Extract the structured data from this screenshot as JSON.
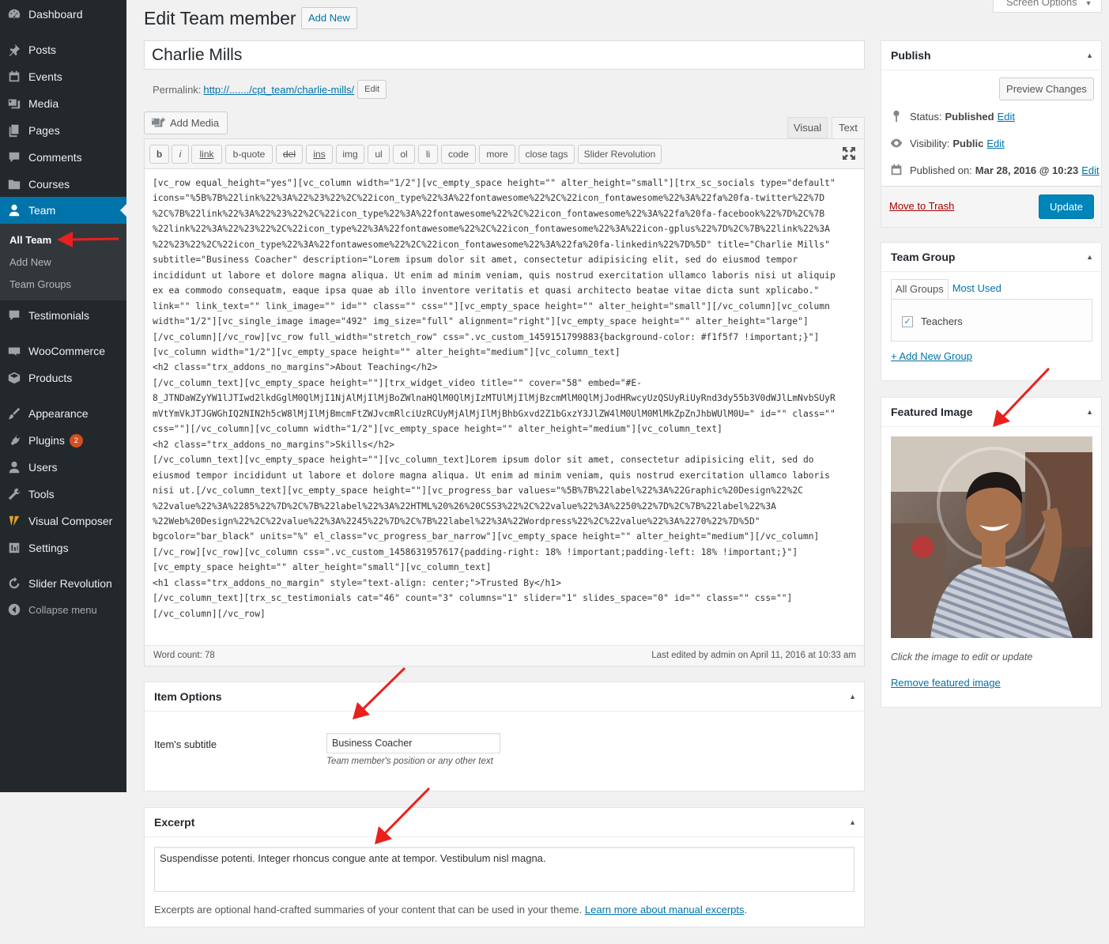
{
  "sidebar": {
    "items": [
      {
        "label": "Dashboard",
        "icon": "dashboard-icon"
      },
      {
        "label": "Posts",
        "icon": "pin-icon"
      },
      {
        "label": "Events",
        "icon": "calendar-icon"
      },
      {
        "label": "Media",
        "icon": "media-icon"
      },
      {
        "label": "Pages",
        "icon": "pages-icon"
      },
      {
        "label": "Comments",
        "icon": "comment-icon"
      },
      {
        "label": "Courses",
        "icon": "folder-icon"
      },
      {
        "label": "Team",
        "icon": "user-icon"
      },
      {
        "label": "Testimonials",
        "icon": "comment-icon"
      },
      {
        "label": "WooCommerce",
        "icon": "woo-icon"
      },
      {
        "label": "Products",
        "icon": "box-icon"
      },
      {
        "label": "Appearance",
        "icon": "brush-icon"
      },
      {
        "label": "Plugins",
        "icon": "plug-icon",
        "badge": "2"
      },
      {
        "label": "Users",
        "icon": "user-icon"
      },
      {
        "label": "Tools",
        "icon": "wrench-icon"
      },
      {
        "label": "Visual Composer",
        "icon": "vc-icon"
      },
      {
        "label": "Settings",
        "icon": "settings-icon"
      },
      {
        "label": "Slider Revolution",
        "icon": "refresh-icon"
      },
      {
        "label": "Collapse menu",
        "icon": "collapse-icon"
      }
    ],
    "team_submenu": [
      "All Team",
      "Add New",
      "Team Groups"
    ]
  },
  "header": {
    "title": "Edit Team member",
    "add_new": "Add New",
    "screen_options": "Screen Options"
  },
  "post": {
    "title": "Charlie Mills",
    "permalink_label": "Permalink:",
    "permalink_url": "http://......./cpt_team/charlie-mills/",
    "edit_label": "Edit"
  },
  "editor": {
    "add_media": "Add Media",
    "tab_visual": "Visual",
    "tab_text": "Text",
    "toolbar": [
      "b",
      "i",
      "link",
      "b-quote",
      "del",
      "ins",
      "img",
      "ul",
      "ol",
      "li",
      "code",
      "more",
      "close tags",
      "Slider Revolution"
    ],
    "content": "[vc_row equal_height=\"yes\"][vc_column width=\"1/2\"][vc_empty_space height=\"\" alter_height=\"small\"][trx_sc_socials type=\"default\"\nicons=\"%5B%7B%22link%22%3A%22%23%22%2C%22icon_type%22%3A%22fontawesome%22%2C%22icon_fontawesome%22%3A%22fa%20fa-twitter%22%7D\n%2C%7B%22link%22%3A%22%23%22%2C%22icon_type%22%3A%22fontawesome%22%2C%22icon_fontawesome%22%3A%22fa%20fa-facebook%22%7D%2C%7B\n%22link%22%3A%22%23%22%2C%22icon_type%22%3A%22fontawesome%22%2C%22icon_fontawesome%22%3A%22icon-gplus%22%7D%2C%7B%22link%22%3A\n%22%23%22%2C%22icon_type%22%3A%22fontawesome%22%2C%22icon_fontawesome%22%3A%22fa%20fa-linkedin%22%7D%5D\" title=\"Charlie Mills\"\nsubtitle=\"Business Coacher\" description=\"Lorem ipsum dolor sit amet, consectetur adipisicing elit, sed do eiusmod tempor\nincididunt ut labore et dolore magna aliqua. Ut enim ad minim veniam, quis nostrud exercitation ullamco laboris nisi ut aliquip\nex ea commodo consequatm, eaque ipsa quae ab illo inventore veritatis et quasi architecto beatae vitae dicta sunt xplicabo.\"\nlink=\"\" link_text=\"\" link_image=\"\" id=\"\" class=\"\" css=\"\"][vc_empty_space height=\"\" alter_height=\"small\"][/vc_column][vc_column\nwidth=\"1/2\"][vc_single_image image=\"492\" img_size=\"full\" alignment=\"right\"][vc_empty_space height=\"\" alter_height=\"large\"]\n[/vc_column][/vc_row][vc_row full_width=\"stretch_row\" css=\".vc_custom_1459151799883{background-color: #f1f5f7 !important;}\"]\n[vc_column width=\"1/2\"][vc_empty_space height=\"\" alter_height=\"medium\"][vc_column_text]\n<h2 class=\"trx_addons_no_margins\">About Teaching</h2>\n[/vc_column_text][vc_empty_space height=\"\"][trx_widget_video title=\"\" cover=\"58\" embed=\"#E-\n8_JTNDaWZyYW1lJTIwd2lkdGglM0QlMjI1NjAlMjIlMjBoZWlnaHQlM0QlMjIzMTUlMjIlMjBzcmMlM0QlMjJodHRwcyUzQSUyRiUyRnd3dy55b3V0dWJlLmNvbSUyR\nmVtYmVkJTJGWGhIQ2NIN2h5cW8lMjIlMjBmcmFtZWJvcmRlciUzRCUyMjAlMjIlMjBhbGxvd2Z1bGxzY3JlZW4lM0UlM0MlMkZpZnJhbWUlM0U=\" id=\"\" class=\"\"\ncss=\"\"][/vc_column][vc_column width=\"1/2\"][vc_empty_space height=\"\" alter_height=\"medium\"][vc_column_text]\n<h2 class=\"trx_addons_no_margins\">Skills</h2>\n[/vc_column_text][vc_empty_space height=\"\"][vc_column_text]Lorem ipsum dolor sit amet, consectetur adipisicing elit, sed do\neiusmod tempor incididunt ut labore et dolore magna aliqua. Ut enim ad minim veniam, quis nostrud exercitation ullamco laboris\nnisi ut.[/vc_column_text][vc_empty_space height=\"\"][vc_progress_bar values=\"%5B%7B%22label%22%3A%22Graphic%20Design%22%2C\n%22value%22%3A%2285%22%7D%2C%7B%22label%22%3A%22HTML%20%26%20CSS3%22%2C%22value%22%3A%2250%22%7D%2C%7B%22label%22%3A\n%22Web%20Design%22%2C%22value%22%3A%2245%22%7D%2C%7B%22label%22%3A%22Wordpress%22%2C%22value%22%3A%2270%22%7D%5D\"\nbgcolor=\"bar_black\" units=\"%\" el_class=\"vc_progress_bar_narrow\"][vc_empty_space height=\"\" alter_height=\"medium\"][/vc_column]\n[/vc_row][vc_row][vc_column css=\".vc_custom_1458631957617{padding-right: 18% !important;padding-left: 18% !important;}\"]\n[vc_empty_space height=\"\" alter_height=\"small\"][vc_column_text]\n<h1 class=\"trx_addons_no_margin\" style=\"text-align: center;\">Trusted By</h1>\n[/vc_column_text][trx_sc_testimonials cat=\"46\" count=\"3\" columns=\"1\" slider=\"1\" slides_space=\"0\" id=\"\" class=\"\" css=\"\"]\n[/vc_column][/vc_row]",
    "word_count": "Word count: 78",
    "last_edited": "Last edited by admin on April 11, 2016 at 10:33 am"
  },
  "item_options": {
    "title": "Item Options",
    "subtitle_label": "Item's subtitle",
    "subtitle_value": "Business Coacher",
    "subtitle_desc": "Team member's position or any other text"
  },
  "excerpt": {
    "title": "Excerpt",
    "value": "Suspendisse potenti. Integer rhoncus congue ante at tempor. Vestibulum nisl magna.",
    "help": "Excerpts are optional hand-crafted summaries of your content that can be used in your theme.",
    "help_link": "Learn more about manual excerpts",
    "help_end": "."
  },
  "publish": {
    "title": "Publish",
    "preview": "Preview Changes",
    "status_label": "Status:",
    "status_value": "Published",
    "visibility_label": "Visibility:",
    "visibility_value": "Public",
    "published_label": "Published on:",
    "published_value": "Mar 28, 2016 @ 10:23",
    "edit": "Edit",
    "trash": "Move to Trash",
    "update": "Update"
  },
  "team_group": {
    "title": "Team Group",
    "tab_all": "All Groups",
    "tab_used": "Most Used",
    "item": "Teachers",
    "add_new": "+ Add New Group"
  },
  "featured_image": {
    "title": "Featured Image",
    "hint": "Click the image to edit or update",
    "remove": "Remove featured image"
  },
  "colors": {
    "sidebar_bg": "#23282d",
    "accent": "#0073aa",
    "annotation_arrow": "#e8211d"
  }
}
